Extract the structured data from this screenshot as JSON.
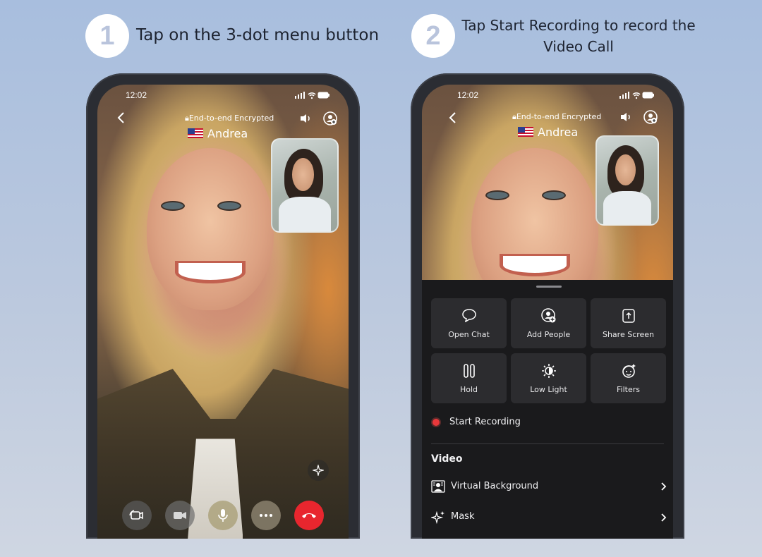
{
  "steps": [
    {
      "number": "1",
      "text": "Tap on the 3-dot menu button"
    },
    {
      "number": "2",
      "text_line1": "Tap Start Recording to record the",
      "text_line2": "Video Call"
    }
  ],
  "call": {
    "time": "12:02",
    "encryption": "End-to-end Encrypted",
    "contact_name": "Andrea"
  },
  "menu": {
    "tiles": [
      {
        "label": "Open Chat",
        "icon": "chat-bubble-icon"
      },
      {
        "label": "Add People",
        "icon": "add-person-icon"
      },
      {
        "label": "Share Screen",
        "icon": "share-screen-icon"
      },
      {
        "label": "Hold",
        "icon": "pause-icon"
      },
      {
        "label": "Low Light",
        "icon": "low-light-icon"
      },
      {
        "label": "Filters",
        "icon": "filter-face-icon"
      }
    ],
    "start_recording": "Start Recording",
    "video_section": "Video",
    "virtual_background": "Virtual Background",
    "mask": "Mask"
  },
  "colors": {
    "end_call": "#e8262e",
    "record_dot": "#e8383b",
    "sheet_bg": "#1a1a1c",
    "tile_bg": "#2c2c2f"
  }
}
